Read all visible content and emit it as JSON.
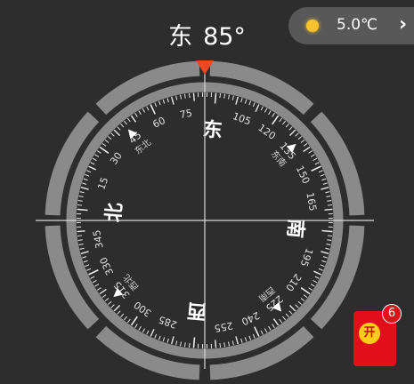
{
  "heading": {
    "direction": "东",
    "degrees": "85°"
  },
  "weather": {
    "icon": "sun-icon",
    "temperature": "5.0℃",
    "chevron": "›"
  },
  "compass": {
    "rotation_deg": 85,
    "degree_labels": [
      "15",
      "30",
      "45",
      "60",
      "75",
      "105",
      "120",
      "135",
      "150",
      "165",
      "195",
      "210",
      "225",
      "240",
      "255",
      "285",
      "300",
      "315",
      "330",
      "345"
    ],
    "cardinal_labels": [
      "北",
      "东",
      "南",
      "西"
    ],
    "intercardinal_labels": [
      "东北",
      "东南",
      "西南",
      "西北"
    ],
    "pointer_color": "#ef4623"
  },
  "red_packet": {
    "icon_text": "开",
    "badge_count": "6"
  }
}
